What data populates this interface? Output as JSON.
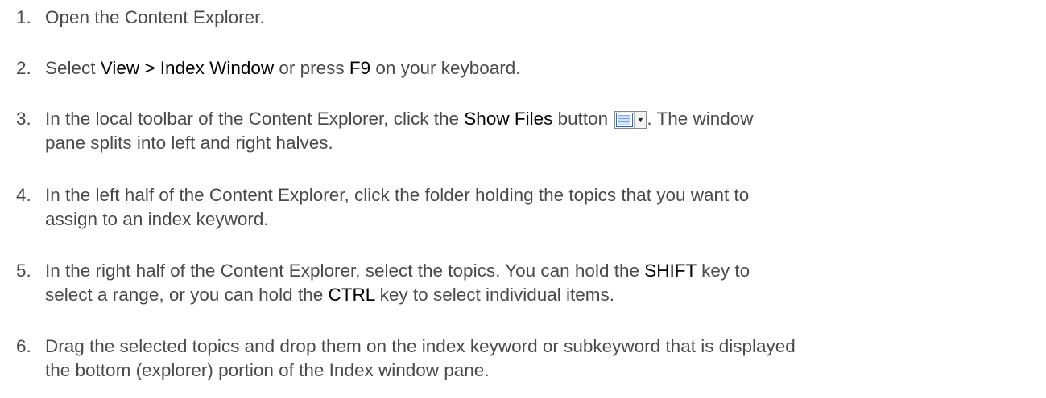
{
  "steps": [
    {
      "num": "1.",
      "parts": [
        "Open the Content Explorer."
      ]
    },
    {
      "num": "2.",
      "pre": "Select ",
      "k1": "View > Index Window",
      "mid": " or press ",
      "k2": "F9",
      "post": " on your keyboard."
    },
    {
      "num": "3.",
      "pre": "In the local toolbar of the Content Explorer, click the ",
      "k1": "Show Files",
      "mid": " button ",
      "post": ". The window",
      "line2": "pane splits into left and right halves."
    },
    {
      "num": "4.",
      "line1": "In the left half of the Content Explorer, click the folder holding the topics that you want to",
      "line2": "assign to an index keyword."
    },
    {
      "num": "5.",
      "pre": "In the right half of the Content Explorer, select the topics. You can hold the ",
      "k1": "SHIFT",
      "post": " key to",
      "l2pre": "select a range, or you can hold the ",
      "k2": "CTRL",
      "l2post": " key to select individual items."
    },
    {
      "num": "6.",
      "line1": "Drag the selected topics and drop them on the index keyword or subkeyword that is displayed",
      "line2": "the bottom (explorer) portion of the Index window pane."
    }
  ],
  "icons": {
    "show_files": "show-files-grid-icon",
    "dropdown": "dropdown-arrow-icon"
  }
}
